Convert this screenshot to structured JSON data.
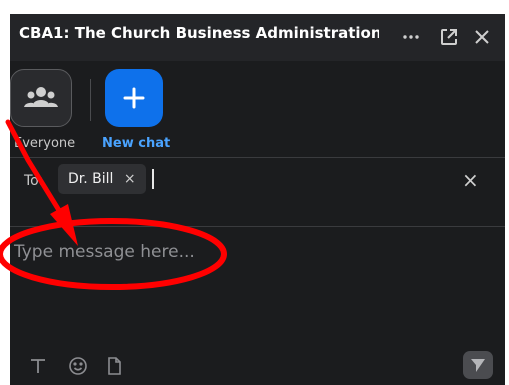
{
  "window": {
    "title": "CBA1: The Church Business Administration ...",
    "more_icon": "more-icon",
    "popout_icon": "popout-icon",
    "close_icon": "close-icon"
  },
  "recipients_picker": {
    "everyone_label": "Everyone",
    "new_chat_label": "New chat"
  },
  "to_field": {
    "label": "To:",
    "chip_name": "Dr. Bill",
    "chip_remove": "×",
    "clear": "×"
  },
  "composer": {
    "placeholder": "Type message here..."
  },
  "colors": {
    "panel_bg": "#1b1c1e",
    "titlebar_bg": "#242528",
    "accent_blue": "#0e71eb",
    "new_chat_text": "#4aa3ff",
    "annotation_red": "#ff0000"
  }
}
